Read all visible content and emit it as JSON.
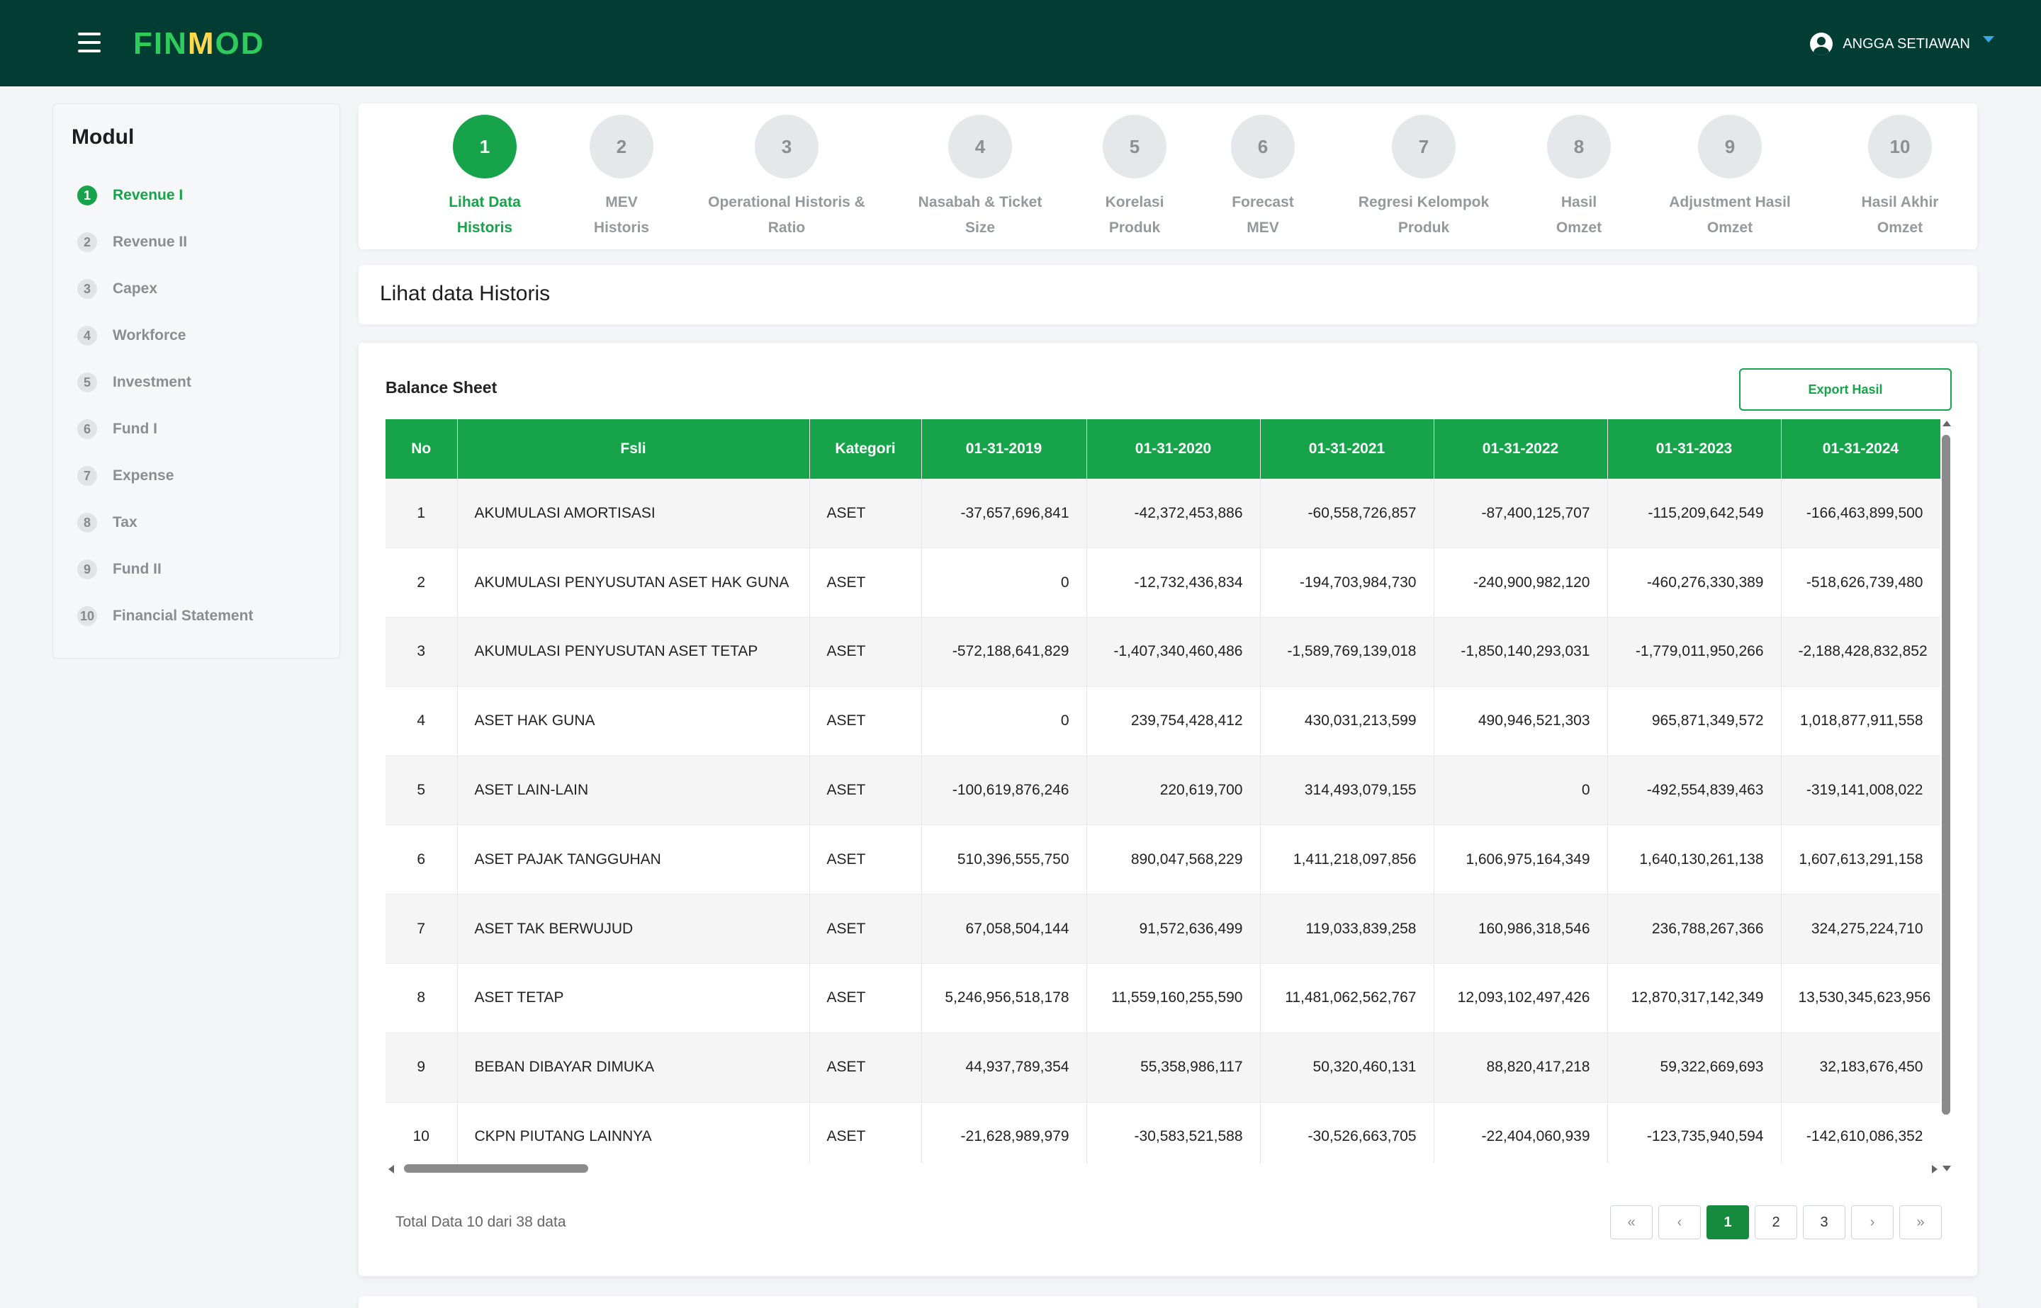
{
  "header": {
    "logo": {
      "part1": "FIN",
      "part2": "M",
      "part3": "OD"
    },
    "user_name": "ANGGA SETIAWAN"
  },
  "sidebar": {
    "title": "Modul",
    "items": [
      {
        "num": "1",
        "label": "Revenue I"
      },
      {
        "num": "2",
        "label": "Revenue II"
      },
      {
        "num": "3",
        "label": "Capex"
      },
      {
        "num": "4",
        "label": "Workforce"
      },
      {
        "num": "5",
        "label": "Investment"
      },
      {
        "num": "6",
        "label": "Fund I"
      },
      {
        "num": "7",
        "label": "Expense"
      },
      {
        "num": "8",
        "label": "Tax"
      },
      {
        "num": "9",
        "label": "Fund II"
      },
      {
        "num": "10",
        "label": "Financial Statement"
      }
    ]
  },
  "steps": [
    {
      "num": "1",
      "line1": "Lihat Data",
      "line2": "Historis"
    },
    {
      "num": "2",
      "line1": "MEV",
      "line2": "Historis"
    },
    {
      "num": "3",
      "line1": "Operational Historis &",
      "line2": "Ratio"
    },
    {
      "num": "4",
      "line1": "Nasabah & Ticket",
      "line2": "Size"
    },
    {
      "num": "5",
      "line1": "Korelasi",
      "line2": "Produk"
    },
    {
      "num": "6",
      "line1": "Forecast",
      "line2": "MEV"
    },
    {
      "num": "7",
      "line1": "Regresi Kelompok",
      "line2": "Produk"
    },
    {
      "num": "8",
      "line1": "Hasil",
      "line2": "Omzet"
    },
    {
      "num": "9",
      "line1": "Adjustment Hasil",
      "line2": "Omzet"
    },
    {
      "num": "10",
      "line1": "Hasil Akhir",
      "line2": "Omzet"
    }
  ],
  "page_title": "Lihat data Historis",
  "card": {
    "subtitle": "Balance Sheet",
    "export_label": "Export Hasil"
  },
  "table": {
    "headers": [
      "No",
      "Fsli",
      "Kategori",
      "01-31-2019",
      "01-31-2020",
      "01-31-2021",
      "01-31-2022",
      "01-31-2023",
      "01-31-2024"
    ],
    "rows": [
      [
        "1",
        "AKUMULASI AMORTISASI",
        "ASET",
        "-37,657,696,841",
        "-42,372,453,886",
        "-60,558,726,857",
        "-87,400,125,707",
        "-115,209,642,549",
        "-166,463,899,500"
      ],
      [
        "2",
        "AKUMULASI PENYUSUTAN ASET HAK GUNA",
        "ASET",
        "0",
        "-12,732,436,834",
        "-194,703,984,730",
        "-240,900,982,120",
        "-460,276,330,389",
        "-518,626,739,480"
      ],
      [
        "3",
        "AKUMULASI PENYUSUTAN ASET TETAP",
        "ASET",
        "-572,188,641,829",
        "-1,407,340,460,486",
        "-1,589,769,139,018",
        "-1,850,140,293,031",
        "-1,779,011,950,266",
        "-2,188,428,832,852"
      ],
      [
        "4",
        "ASET HAK GUNA",
        "ASET",
        "0",
        "239,754,428,412",
        "430,031,213,599",
        "490,946,521,303",
        "965,871,349,572",
        "1,018,877,911,558"
      ],
      [
        "5",
        "ASET LAIN-LAIN",
        "ASET",
        "-100,619,876,246",
        "220,619,700",
        "314,493,079,155",
        "0",
        "-492,554,839,463",
        "-319,141,008,022"
      ],
      [
        "6",
        "ASET PAJAK TANGGUHAN",
        "ASET",
        "510,396,555,750",
        "890,047,568,229",
        "1,411,218,097,856",
        "1,606,975,164,349",
        "1,640,130,261,138",
        "1,607,613,291,158"
      ],
      [
        "7",
        "ASET TAK BERWUJUD",
        "ASET",
        "67,058,504,144",
        "91,572,636,499",
        "119,033,839,258",
        "160,986,318,546",
        "236,788,267,366",
        "324,275,224,710"
      ],
      [
        "8",
        "ASET TETAP",
        "ASET",
        "5,246,956,518,178",
        "11,559,160,255,590",
        "11,481,062,562,767",
        "12,093,102,497,426",
        "12,870,317,142,349",
        "13,530,345,623,956"
      ],
      [
        "9",
        "BEBAN DIBAYAR DIMUKA",
        "ASET",
        "44,937,789,354",
        "55,358,986,117",
        "50,320,460,131",
        "88,820,417,218",
        "59,322,669,693",
        "32,183,676,450"
      ],
      [
        "10",
        "CKPN PIUTANG LAINNYA",
        "ASET",
        "-21,628,989,979",
        "-30,583,521,588",
        "-30,526,663,705",
        "-22,404,060,939",
        "-123,735,940,594",
        "-142,610,086,352"
      ]
    ]
  },
  "footer": {
    "total_text": "Total Data 10 dari 38 data",
    "pages": [
      "1",
      "2",
      "3"
    ],
    "first_glyph": "«",
    "prev_glyph": "‹",
    "next_glyph": "›",
    "last_glyph": "»"
  }
}
